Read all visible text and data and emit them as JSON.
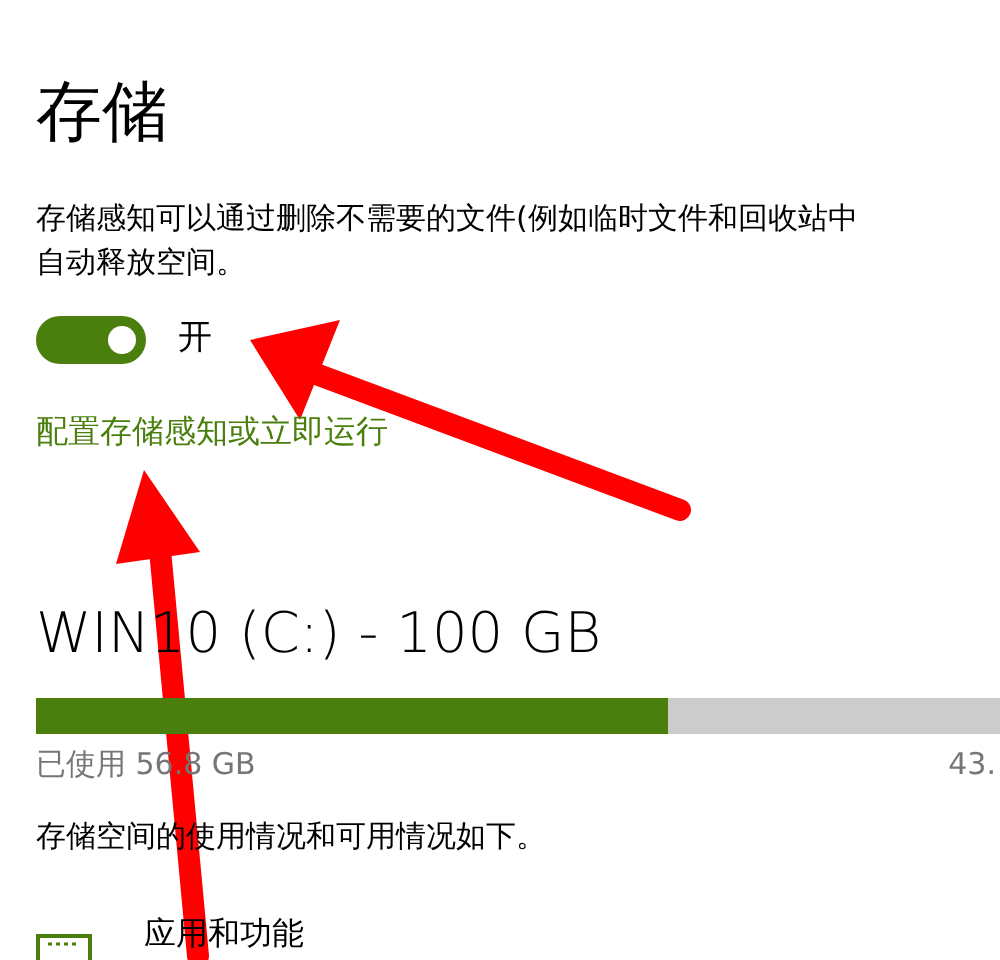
{
  "title": "存储",
  "storage_sense": {
    "description_lines": [
      "存储感知可以通过删除不需要的文件(例如临时文件和回收站中",
      "自动释放空间。"
    ],
    "toggle": {
      "on": true,
      "label": "开"
    },
    "link": "配置存储感知或立即运行"
  },
  "drive": {
    "heading": "WIN10 (C:) - 100 GB",
    "usage": {
      "level": 0.568
    },
    "used_label": "已使用 56.8 GB",
    "free_label": "43."
  },
  "summary": "存储空间的使用情况和可用情况如下。",
  "categories": [
    {
      "label": "应用和功能"
    }
  ]
}
